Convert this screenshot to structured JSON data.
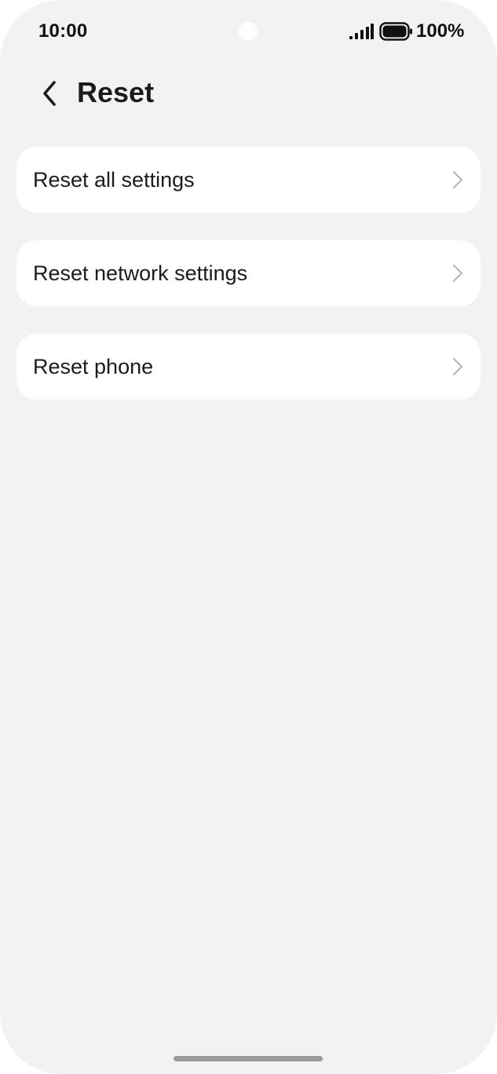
{
  "status_bar": {
    "time": "10:00",
    "battery_percent": "100%",
    "battery_level": 1.0,
    "signal_icon": "cellular-signal-icon",
    "battery_icon": "battery-icon"
  },
  "header": {
    "back_icon": "chevron-left-icon",
    "title": "Reset"
  },
  "settings_list": {
    "items": [
      {
        "label": "Reset all settings",
        "icon": "chevron-right-icon"
      },
      {
        "label": "Reset network settings",
        "icon": "chevron-right-icon"
      },
      {
        "label": "Reset phone",
        "icon": "chevron-right-icon"
      }
    ]
  },
  "colors": {
    "background": "#f1f2f4",
    "card": "#ffffff",
    "text": "#1b1b1b",
    "chevron": "#b5b5b8"
  }
}
